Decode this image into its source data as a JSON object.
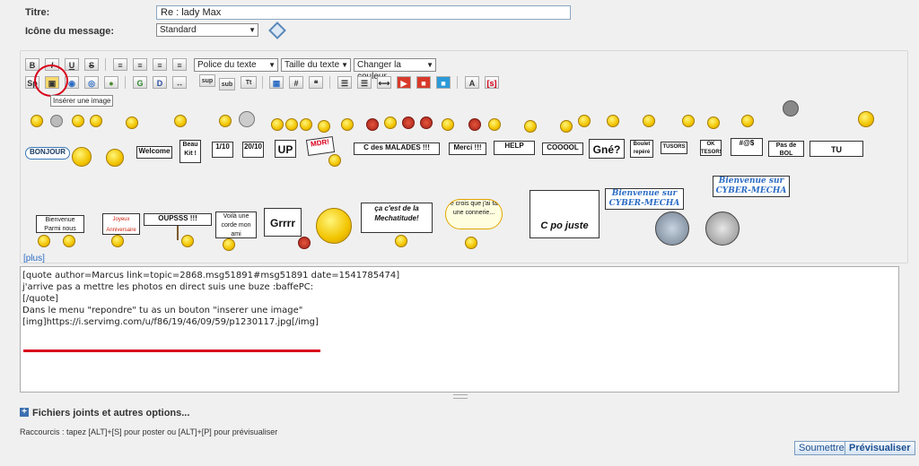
{
  "form": {
    "title_label": "Titre:",
    "title_value": "Re : lady Max",
    "icon_label": "Icône du message:",
    "icon_value": "Standard"
  },
  "toolbar": {
    "row1": [
      "B",
      "I",
      "U",
      "S"
    ],
    "font_select": "Police du texte",
    "size_select": "Taille du texte",
    "color_select": "Changer la couleur",
    "row2_labels": [
      "Sp",
      "sup",
      "sub",
      "Tt",
      "#"
    ],
    "tooltip": "Insérer une image"
  },
  "smileys": {
    "signs": [
      "BONJOUR",
      "Welcome",
      "Beau Kit !",
      "UP",
      "MDR!",
      "C des MALADES !!!",
      "Merci !!!",
      "HELP",
      "COOOOL",
      "Gné?",
      "Boulet repéré",
      "TUSORS",
      "OK TESORS",
      "Pas de BOL",
      "TU CARTONNES!",
      "Bienvenue Parmi nous",
      "Joyeux Anniversaire",
      "OUPSSS !!!",
      "Voilà une corde mon ami",
      "Grrrr",
      "ça c'est de la Mechatitude!",
      "Je crois que j'ai fait une connerie...",
      "C po juste",
      "Bienvenue sur CYBER-MECHA",
      "Bienvenue sur CYBER-MECHA"
    ],
    "more_link": "[plus]"
  },
  "editor": {
    "lines": [
      "[quote author=Marcus link=topic=2868.msg51891#msg51891 date=1541785474]",
      "j'arrive pas a mettre les photos en direct suis une buze :baffePC:",
      "[/quote]",
      "",
      "Dans le menu \"repondre\" tu as un bouton \"inserer une image\"",
      "",
      "[img]https://i.servimg.com/u/f86/19/46/09/59/p1230117.jpg[/img]"
    ]
  },
  "attachments_label": "Fichiers joints et autres options...",
  "shortcuts": "Raccourcis : tapez [ALT]+[S] pour poster ou [ALT]+[P] pour prévisualiser",
  "buttons": {
    "submit": "Soumettre",
    "preview": "Prévisualiser"
  },
  "colors": {
    "accent": "#1d4f91",
    "highlight_red": "#d8001b"
  }
}
